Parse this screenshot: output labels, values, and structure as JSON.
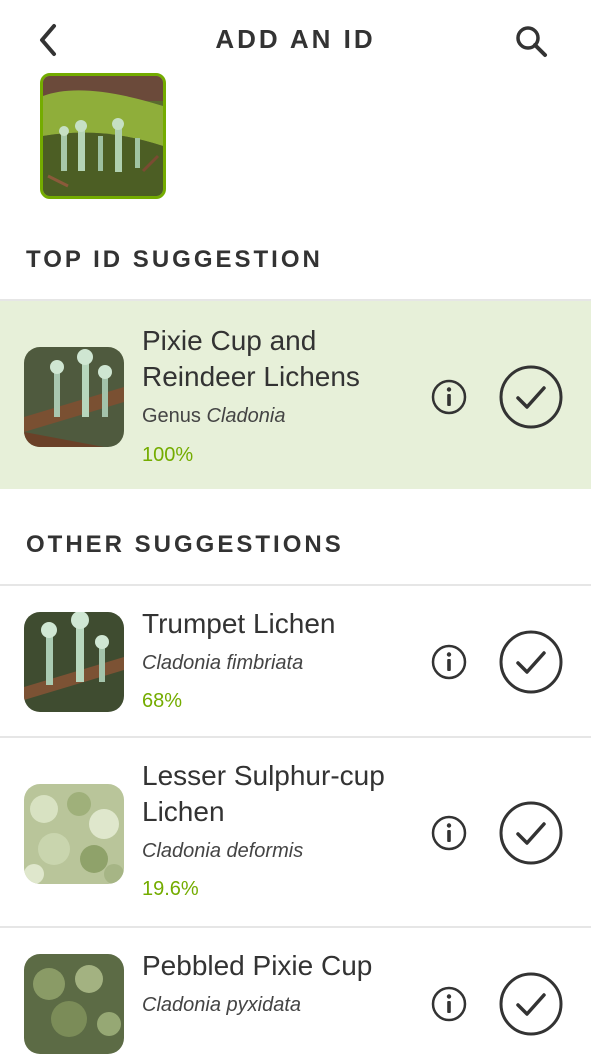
{
  "header": {
    "title": "ADD AN ID"
  },
  "sections": {
    "top": "TOP ID SUGGESTION",
    "other": "OTHER SUGGESTIONS"
  },
  "top_suggestion": {
    "name": "Pixie Cup and Reindeer Lichens",
    "rank": "Genus",
    "scientific": "Cladonia",
    "score": "100%"
  },
  "other_suggestions": [
    {
      "name": "Trumpet Lichen",
      "scientific": "Cladonia fimbriata",
      "score": "68%"
    },
    {
      "name": "Lesser Sulphur-cup Lichen",
      "scientific": "Cladonia deformis",
      "score": "19.6%"
    },
    {
      "name": "Pebbled Pixie Cup",
      "scientific": "Cladonia pyxidata",
      "score": ""
    }
  ],
  "colors": {
    "accent": "#74ac00",
    "highlight": "#e7f0d9",
    "text": "#333333"
  },
  "icons": {
    "back": "chevron-left-icon",
    "search": "search-icon",
    "info": "info-icon",
    "select": "check-circle-icon"
  }
}
